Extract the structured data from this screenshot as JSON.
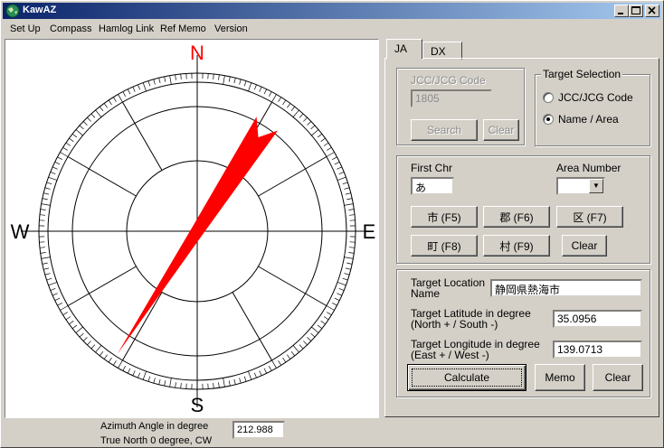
{
  "window": {
    "title": "KawAZ"
  },
  "menu": [
    "Set Up",
    "Compass",
    "Hamlog Link",
    "Ref Memo",
    "Version"
  ],
  "compass": {
    "north": "N",
    "south": "S",
    "east": "E",
    "west": "W",
    "azimuth_degrees": 212.988,
    "colors": {
      "needle": "#ff0000",
      "north_label": "#ff0000"
    }
  },
  "azimuth": {
    "label_line1": "Azimuth Angle in degree",
    "label_line2": "True North 0 degree, CW",
    "value": "212.988"
  },
  "tabs": [
    {
      "label": "JA",
      "active": true
    },
    {
      "label": "DX",
      "active": false
    }
  ],
  "jcc": {
    "label": "JCC/JCG Code",
    "value": "1805",
    "search_label": "Search",
    "clear_label": "Clear"
  },
  "target_selection": {
    "legend": "Target Selection",
    "options": [
      {
        "label": "JCC/JCG Code",
        "checked": false
      },
      {
        "label": "Name / Area",
        "checked": true
      }
    ]
  },
  "first_chr": {
    "label": "First Chr",
    "value": "あ"
  },
  "area_number": {
    "label": "Area Number",
    "value": ""
  },
  "area_buttons": {
    "shi": "市 (F5)",
    "gun": "郡 (F6)",
    "ku": "区 (F7)",
    "machi": "町 (F8)",
    "mura": "村 (F9)",
    "clear": "Clear"
  },
  "target": {
    "location_label_1": "Target Location",
    "location_label_2": "Name",
    "location_value": "静岡県熱海市",
    "lat_label_1": "Target Latitude in degree",
    "lat_label_2": "(North + / South -)",
    "lat_value": "35.0956",
    "lon_label_1": "Target Longitude in degree",
    "lon_label_2": "(East + / West -)",
    "lon_value": "139.0713"
  },
  "actions": {
    "calculate": "Calculate",
    "memo": "Memo",
    "clear": "Clear"
  }
}
